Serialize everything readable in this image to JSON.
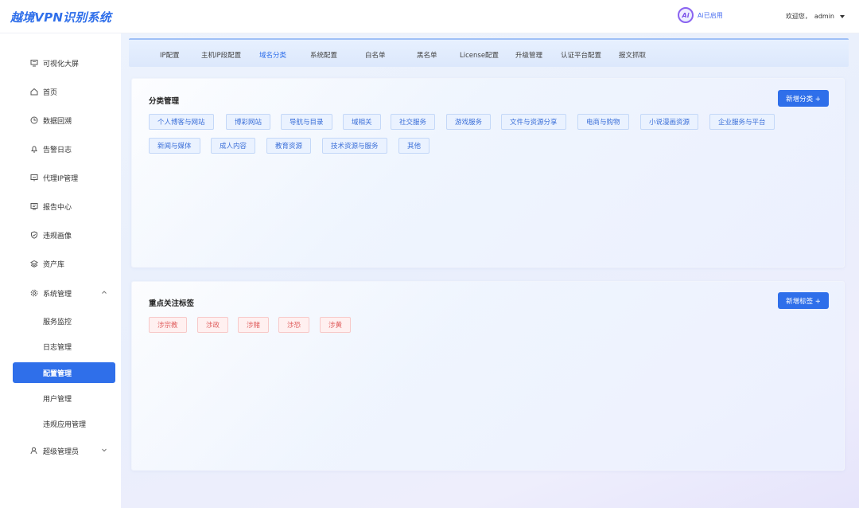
{
  "header": {
    "logo": "越境VPN识别系统",
    "ai_badge": "Ai",
    "ai_status": "Ai已启用",
    "welcome": "欢迎您，",
    "username": "admin"
  },
  "sidebar": {
    "items": [
      {
        "label": "可视化大屏",
        "icon": "screen-icon"
      },
      {
        "label": "首页",
        "icon": "home-icon"
      },
      {
        "label": "数据回溯",
        "icon": "clock-icon"
      },
      {
        "label": "告警日志",
        "icon": "bell-icon"
      },
      {
        "label": "代理IP管理",
        "icon": "proxy-icon"
      },
      {
        "label": "报告中心",
        "icon": "report-icon"
      },
      {
        "label": "违规画像",
        "icon": "shield-icon"
      },
      {
        "label": "资产库",
        "icon": "layers-icon"
      },
      {
        "label": "系统管理",
        "icon": "gear-icon"
      },
      {
        "label": "服务监控"
      },
      {
        "label": "日志管理"
      },
      {
        "label": "配置管理"
      },
      {
        "label": "用户管理"
      },
      {
        "label": "违规应用管理"
      },
      {
        "label": "超级管理员",
        "icon": "user-icon"
      }
    ],
    "active": "配置管理"
  },
  "tabs": [
    "IP配置",
    "主机IP段配置",
    "域名分类",
    "系统配置",
    "白名单",
    "黑名单",
    "License配置",
    "升级管理",
    "认证平台配置",
    "报文抓取"
  ],
  "active_tab": "域名分类",
  "category_card": {
    "title": "分类管理",
    "add_button": "新增分类 +",
    "tags": [
      "个人博客与网站",
      "博彩网站",
      "导航与目录",
      "域相关",
      "社交服务",
      "游戏服务",
      "文件与资源分享",
      "电商与购物",
      "小说漫画资源",
      "企业服务与平台",
      "新闻与媒体",
      "成人内容",
      "教育资源",
      "技术资源与服务",
      "其他"
    ]
  },
  "focus_card": {
    "title": "重点关注标签",
    "add_button": "新增标签 +",
    "tags": [
      "涉宗教",
      "涉政",
      "涉赌",
      "涉恐",
      "涉黄"
    ]
  },
  "colors": {
    "primary": "#2f6fea",
    "tag_blue_bg": "#eaf2ff",
    "tag_red_text": "#e06060"
  }
}
